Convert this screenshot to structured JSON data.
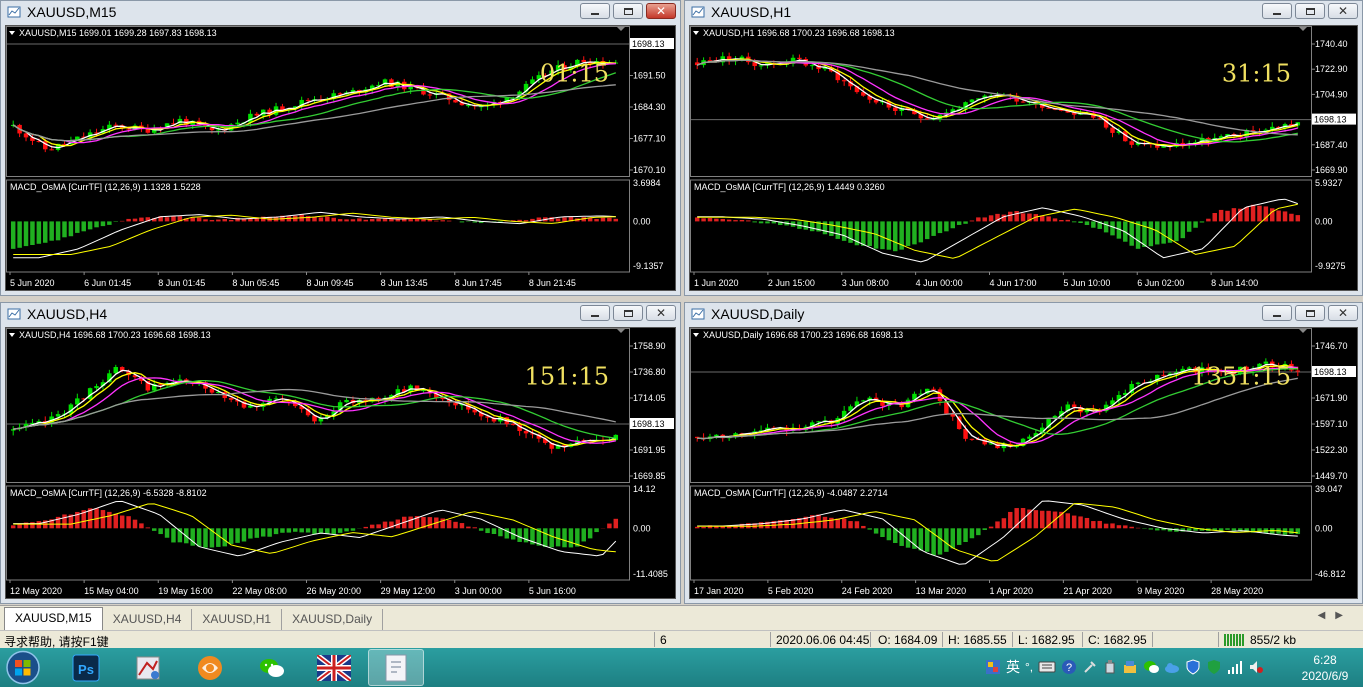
{
  "colors": {
    "bull": "#00e000",
    "bear": "#ff1010",
    "bg": "#000000",
    "pricebox": "#ffffff",
    "countdown": "#f0e060",
    "ma_white": "#ffffff",
    "ma_yellow": "#ffff00",
    "ma_magenta": "#ff33ff",
    "ma_green": "#33cc33",
    "ma_gray": "#9a9a9a",
    "hist_pos": "#e02020",
    "hist_neg": "#20b020"
  },
  "windows": [
    {
      "id": "m15",
      "title": "XAUUSD,M15",
      "active": true,
      "header": "XAUUSD,M15  1699.01 1699.28 1697.83 1698.13",
      "countdown": "01:15",
      "price_ticks": [
        "1698.13",
        "1691.50",
        "1684.30",
        "1677.10",
        "1670.10"
      ],
      "current_price": "1698.13",
      "macd_label": "MACD_OsMA [CurrTF] (12,26,9) 1.1328 1.5228",
      "macd_ticks": [
        "3.6984",
        "0.00",
        "-9.1357"
      ],
      "time_ticks": [
        "5 Jun 2020",
        "6 Jun 01:45",
        "8 Jun 01:45",
        "8 Jun 05:45",
        "8 Jun 09:45",
        "8 Jun 13:45",
        "8 Jun 17:45",
        "8 Jun 21:45"
      ],
      "seed": 11,
      "shape": "m15"
    },
    {
      "id": "h1",
      "title": "XAUUSD,H1",
      "active": false,
      "header": "XAUUSD,H1  1696.68 1700.23 1696.68 1698.13",
      "countdown": "31:15",
      "price_ticks": [
        "1740.40",
        "1722.90",
        "1704.90",
        "1698.13",
        "1687.40",
        "1669.90"
      ],
      "current_price": "1698.13",
      "macd_label": "MACD_OsMA [CurrTF] (12,26,9) 1.4449 0.3260",
      "macd_ticks": [
        "5.9327",
        "0.00",
        "-9.9275"
      ],
      "time_ticks": [
        "1 Jun 2020",
        "2 Jun 15:00",
        "3 Jun 08:00",
        "4 Jun 00:00",
        "4 Jun 17:00",
        "5 Jun 10:00",
        "6 Jun 02:00",
        "8 Jun 14:00"
      ],
      "seed": 23,
      "shape": "h1"
    },
    {
      "id": "h4",
      "title": "XAUUSD,H4",
      "active": false,
      "header": "XAUUSD,H4  1696.68 1700.23 1696.68 1698.13",
      "countdown": "151:15",
      "price_ticks": [
        "1758.90",
        "1736.80",
        "1714.05",
        "1698.13",
        "1691.95",
        "1669.85"
      ],
      "current_price": "1698.13",
      "macd_label": "MACD_OsMA [CurrTF] (12,26,9) -6.5328 -8.8102",
      "macd_ticks": [
        "14.12",
        "0.00",
        "-11.4085"
      ],
      "time_ticks": [
        "12 May 2020",
        "15 May 04:00",
        "19 May 16:00",
        "22 May 08:00",
        "26 May 20:00",
        "29 May 12:00",
        "3 Jun 00:00",
        "5 Jun 16:00"
      ],
      "seed": 37,
      "shape": "h4"
    },
    {
      "id": "d1",
      "title": "XAUUSD,Daily",
      "active": false,
      "header": "XAUUSD,Daily  1696.68 1700.23 1696.68 1698.13",
      "countdown": "1351:15",
      "price_ticks": [
        "1746.70",
        "1698.13",
        "1671.90",
        "1597.10",
        "1522.30",
        "1449.70"
      ],
      "current_price": "1698.13",
      "macd_label": "MACD_OsMA [CurrTF] (12,26,9) -4.0487 2.2714",
      "macd_ticks": [
        "39.047",
        "0.00",
        "-46.812"
      ],
      "time_ticks": [
        "17 Jan 2020",
        "5 Feb 2020",
        "24 Feb 2020",
        "13 Mar 2020",
        "1 Apr 2020",
        "21 Apr 2020",
        "9 May 2020",
        "28 May 2020"
      ],
      "seed": 53,
      "shape": "d1"
    }
  ],
  "tabs": [
    "XAUUSD,M15",
    "XAUUSD,H4",
    "XAUUSD,H1",
    "XAUUSD,Daily"
  ],
  "active_tab": 0,
  "status": {
    "help": "寻求帮助, 请按F1键",
    "profile": "6",
    "datetime": "2020.06.06 04:45",
    "open": "O: 1684.09",
    "high": "H: 1685.55",
    "low": "L: 1682.95",
    "close": "C: 1682.95",
    "traffic": "855/2 kb"
  },
  "taskbar": {
    "apps": [
      "photoshop-icon",
      "paint-icon",
      "browser-icon",
      "wechat-icon",
      "flag-icon",
      "notes-icon"
    ],
    "tray_lang": "英",
    "time": "6:28",
    "date": "2020/6/9"
  }
}
